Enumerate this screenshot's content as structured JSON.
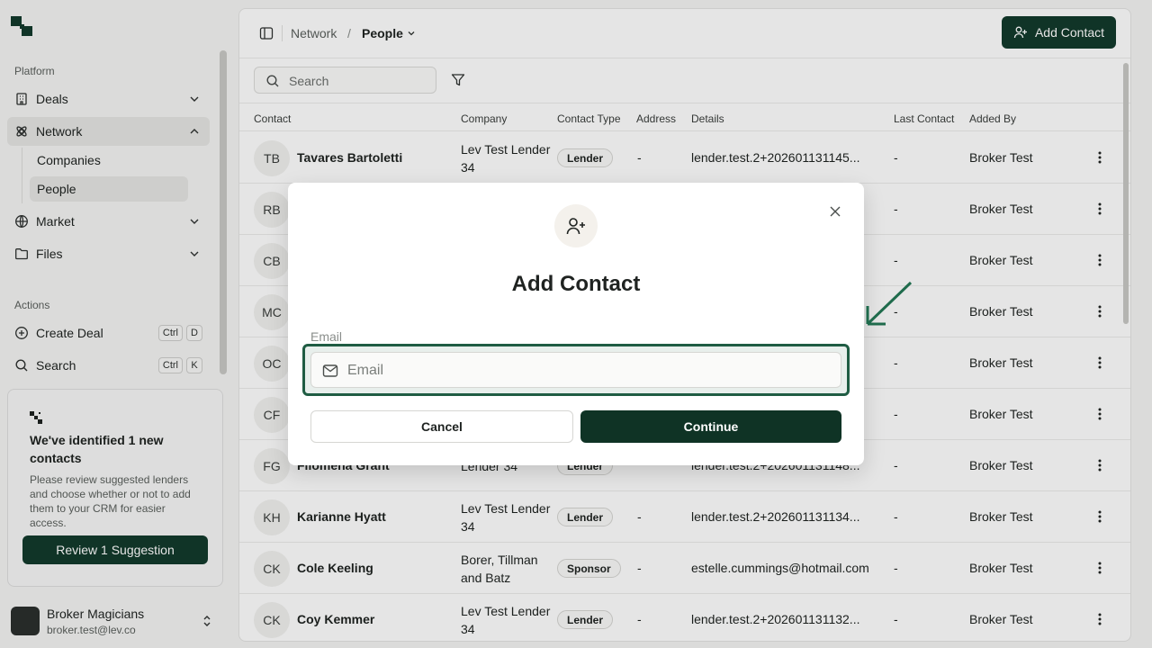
{
  "sidebar": {
    "platform_label": "Platform",
    "actions_label": "Actions",
    "nav": [
      {
        "label": "Deals",
        "icon": "building-icon"
      },
      {
        "label": "Network",
        "icon": "network-icon"
      },
      {
        "label": "Market",
        "icon": "globe-icon"
      },
      {
        "label": "Files",
        "icon": "folder-icon"
      }
    ],
    "network_sub": [
      {
        "label": "Companies"
      },
      {
        "label": "People"
      }
    ],
    "actions": [
      {
        "label": "Create Deal",
        "keys": [
          "Ctrl",
          "D"
        ]
      },
      {
        "label": "Search",
        "keys": [
          "Ctrl",
          "K"
        ]
      }
    ],
    "promo": {
      "title": "We've identified 1 new contacts",
      "description": "Please review suggested lenders and choose whether or not to add them to your CRM for easier access.",
      "button": "Review 1 Suggestion"
    },
    "user": {
      "name": "Broker Magicians",
      "email": "broker.test@lev.co"
    }
  },
  "header": {
    "breadcrumb_parent": "Network",
    "breadcrumb_separator": "/",
    "breadcrumb_current": "People",
    "add_button": "Add Contact"
  },
  "toolbar": {
    "search_placeholder": "Search"
  },
  "table": {
    "columns": [
      "Contact",
      "Company",
      "Contact Type",
      "Address",
      "Details",
      "Last Contact",
      "Added By"
    ],
    "rows": [
      {
        "initials": "TB",
        "name": "Tavares Bartoletti",
        "company": "Lev Test Lender 34",
        "type": "Lender",
        "address": "-",
        "details": "lender.test.2+202601131145...",
        "last": "-",
        "added_by": "Broker Test"
      },
      {
        "initials": "RB",
        "name": "",
        "company": "",
        "type": "",
        "address": "",
        "details": "",
        "last": "-",
        "added_by": "Broker Test"
      },
      {
        "initials": "CB",
        "name": "",
        "company": "",
        "type": "",
        "address": "",
        "details": "",
        "last": "-",
        "added_by": "Broker Test"
      },
      {
        "initials": "MC",
        "name": "",
        "company": "",
        "type": "",
        "address": "",
        "details": "",
        "last": "-",
        "added_by": "Broker Test"
      },
      {
        "initials": "OC",
        "name": "",
        "company": "",
        "type": "",
        "address": "",
        "details": "",
        "last": "-",
        "added_by": "Broker Test"
      },
      {
        "initials": "CF",
        "name": "",
        "company": "",
        "type": "",
        "address": "",
        "details": "",
        "last": "-",
        "added_by": "Broker Test"
      },
      {
        "initials": "FG",
        "name": "Filomena Grant",
        "company": "Lender 34",
        "type": "Lender",
        "address": "",
        "details": "lender.test.2+202601131148...",
        "last": "-",
        "added_by": "Broker Test"
      },
      {
        "initials": "KH",
        "name": "Karianne Hyatt",
        "company": "Lev Test Lender 34",
        "type": "Lender",
        "address": "-",
        "details": "lender.test.2+202601131134...",
        "last": "-",
        "added_by": "Broker Test"
      },
      {
        "initials": "CK",
        "name": "Cole Keeling",
        "company": "Borer, Tillman and Batz",
        "type": "Sponsor",
        "address": "-",
        "details": "estelle.cummings@hotmail.com",
        "last": "-",
        "added_by": "Broker Test"
      },
      {
        "initials": "CK",
        "name": "Coy Kemmer",
        "company": "Lev Test Lender 34",
        "type": "Lender",
        "address": "-",
        "details": "lender.test.2+202601131132...",
        "last": "-",
        "added_by": "Broker Test"
      }
    ]
  },
  "modal": {
    "title": "Add Contact",
    "email_label": "Email",
    "email_placeholder": "Email",
    "email_value": "",
    "cancel": "Cancel",
    "continue": "Continue"
  },
  "colors": {
    "brand": "#123a2c",
    "focus_ring": "#1f5c43",
    "annotation_arrow": "#1f6b4c"
  }
}
